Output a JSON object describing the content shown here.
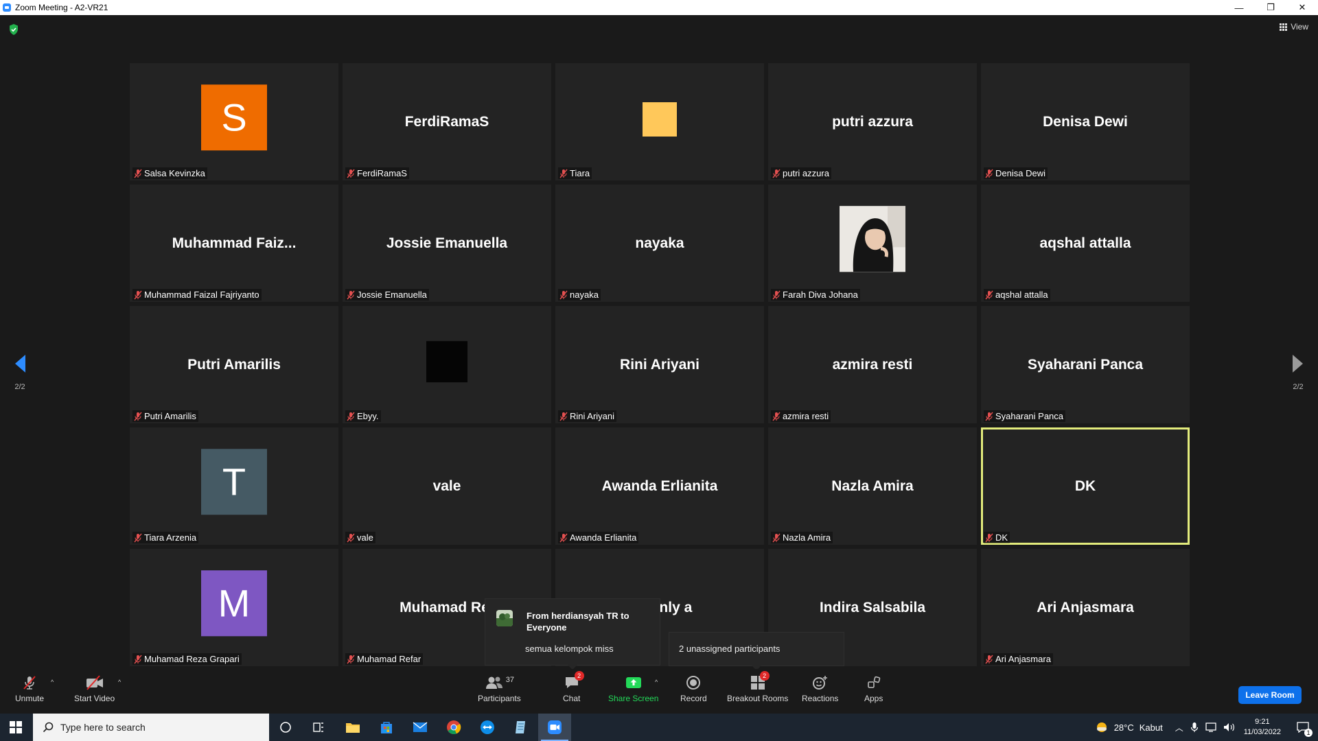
{
  "window": {
    "title": "Zoom Meeting - A2-VR21",
    "controls": {
      "minimize": "—",
      "restore": "❐",
      "close": "✕"
    }
  },
  "meeting": {
    "view_label": "View",
    "page_indicator_left": "2/2",
    "page_indicator_right": "2/2"
  },
  "tiles": [
    {
      "name": "Salsa Kevinzka",
      "display": "",
      "avatar": "letter",
      "letter": "S",
      "color": "#ef6c00"
    },
    {
      "name": "FerdiRamaS",
      "display": "FerdiRamaS"
    },
    {
      "name": "Tiara",
      "display": "",
      "avatar": "square",
      "color": "#ffc85a"
    },
    {
      "name": "putri azzura",
      "display": "putri azzura"
    },
    {
      "name": "Denisa Dewi",
      "display": "Denisa Dewi"
    },
    {
      "name": "Muhammad Faizal Fajriyanto",
      "display": "Muhammad  Faiz..."
    },
    {
      "name": "Jossie Emanuella",
      "display": "Jossie Emanuella"
    },
    {
      "name": "nayaka",
      "display": "nayaka"
    },
    {
      "name": "Farah Diva Johana",
      "display": "",
      "avatar": "photo"
    },
    {
      "name": "aqshal attalla",
      "display": "aqshal attalla"
    },
    {
      "name": "Putri Amarilis",
      "display": "Putri Amarilis"
    },
    {
      "name": "Ebyy.",
      "display": "",
      "avatar": "square",
      "color": "#050505"
    },
    {
      "name": "Rini Ariyani",
      "display": "Rini Ariyani"
    },
    {
      "name": "azmira resti",
      "display": "azmira resti"
    },
    {
      "name": "Syaharani Panca",
      "display": "Syaharani Panca"
    },
    {
      "name": "Tiara Arzenia",
      "display": "",
      "avatar": "letter",
      "letter": "T",
      "color": "#455a64"
    },
    {
      "name": "vale",
      "display": "vale"
    },
    {
      "name": "Awanda Erlianita",
      "display": "Awanda Erlianita"
    },
    {
      "name": "Nazla Amira",
      "display": "Nazla Amira"
    },
    {
      "name": "DK",
      "display": "DK",
      "active": true
    },
    {
      "name": "Muhamad Reza Grapari",
      "display": "",
      "avatar": "letter",
      "letter": "M",
      "color": "#7e57c2"
    },
    {
      "name": "Muhamad Refar",
      "display": "Muhamad Ref"
    },
    {
      "name": "",
      "display": "eavenly a"
    },
    {
      "name": "",
      "display": "Indira Salsabila"
    },
    {
      "name": "Ari Anjasmara",
      "display": "Ari Anjasmara"
    }
  ],
  "chat_popup": {
    "from": "From herdiansyah TR to Everyone",
    "message": "semua kelompok miss"
  },
  "breakout_popup": {
    "text": "2 unassigned participants"
  },
  "toolbar": {
    "unmute": "Unmute",
    "start_video": "Start Video",
    "participants": "Participants",
    "participants_count": "37",
    "chat": "Chat",
    "chat_badge": "2",
    "share_screen": "Share Screen",
    "record": "Record",
    "breakout_rooms": "Breakout Rooms",
    "breakout_badge": "2",
    "reactions": "Reactions",
    "apps": "Apps",
    "leave_room": "Leave Room",
    "colors": {
      "share_green": "#23d959",
      "leave_blue": "#0e71eb",
      "badge_red": "#e02828"
    }
  },
  "taskbar": {
    "search_placeholder": "Type here to search",
    "weather_temp": "28°C",
    "weather_desc": "Kabut",
    "time": "9:21",
    "date": "11/03/2022",
    "notification_count": "1"
  }
}
